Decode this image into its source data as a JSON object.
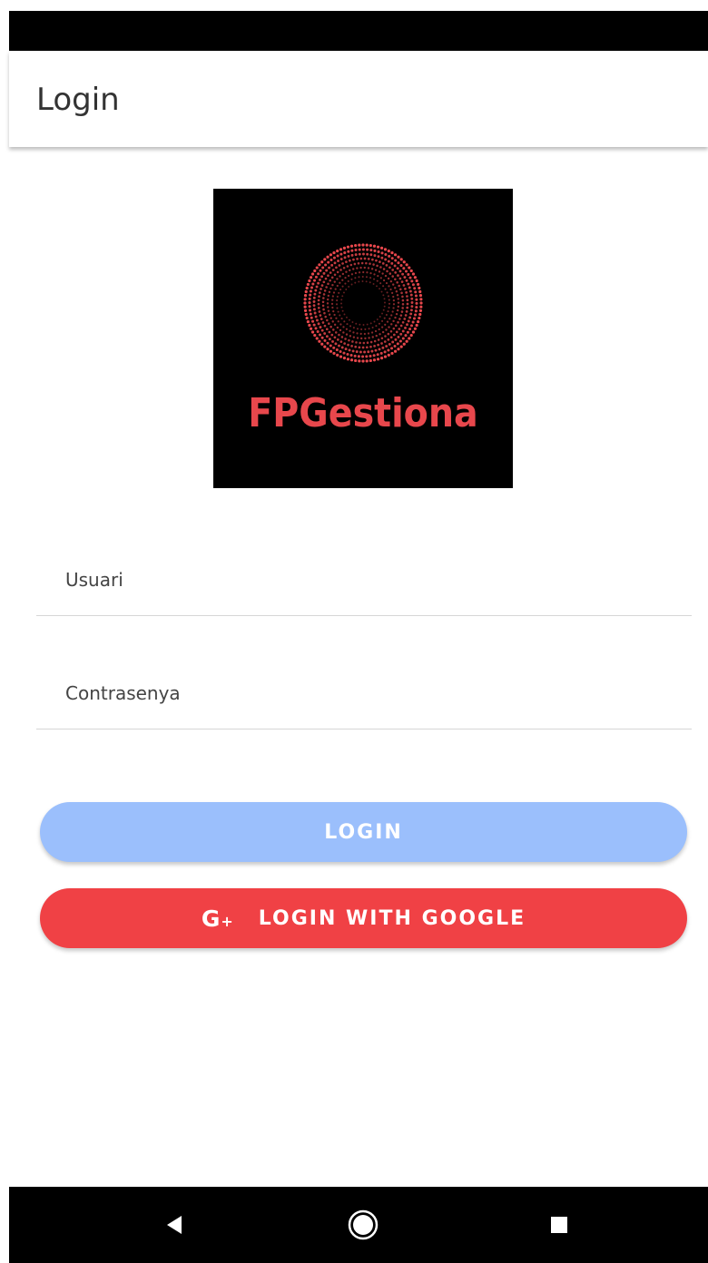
{
  "app_bar": {
    "title": "Login"
  },
  "logo": {
    "text": "FPGestiona",
    "background_color": "#000000",
    "accent_color": "#e8474c"
  },
  "form": {
    "username": {
      "placeholder": "Usuari",
      "value": ""
    },
    "password": {
      "placeholder": "Contrasenya",
      "value": ""
    }
  },
  "buttons": {
    "login_label": "LOGIN",
    "login_color": "#9bbffc",
    "google_label": "LOGIN WITH GOOGLE",
    "google_icon_text": "G",
    "google_icon_plus": "+",
    "google_color": "#f04145"
  },
  "nav_bar": {
    "back_icon": "back-triangle-icon",
    "home_icon": "home-circle-icon",
    "recents_icon": "recents-square-icon"
  }
}
